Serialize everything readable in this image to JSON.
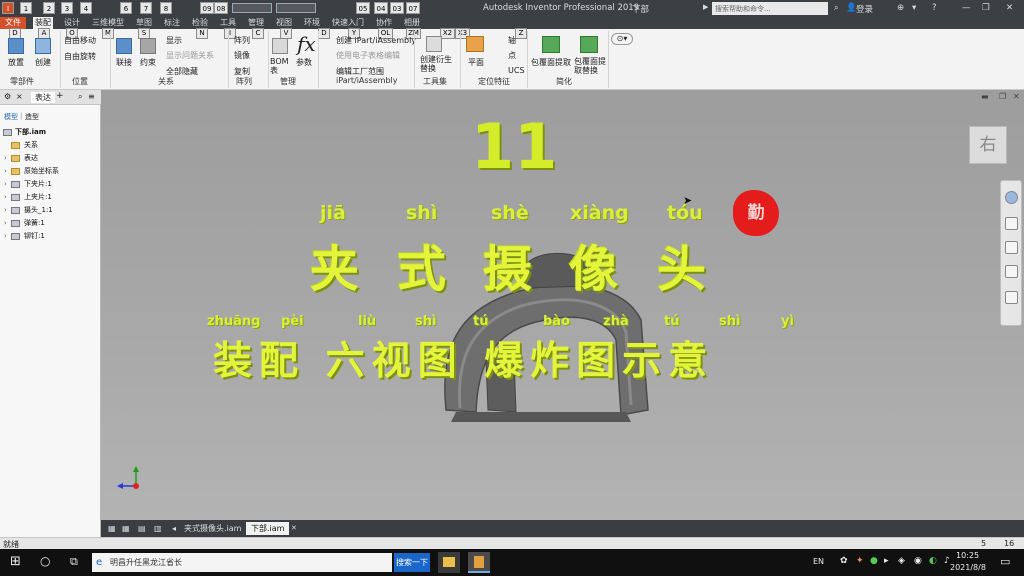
{
  "app": {
    "title": "Autodesk Inventor Professional 2019",
    "document": "下部",
    "search_placeholder": "搜索帮助和命令...",
    "login": "登录"
  },
  "quick_access_keys": [
    "1",
    "2",
    "3",
    "4",
    "6",
    "7",
    "8",
    "09",
    "08"
  ],
  "extra_keys": [
    "05",
    "04",
    "03",
    "07"
  ],
  "menu_tabs": [
    {
      "label": "文件",
      "state": "file"
    },
    {
      "label": "装配",
      "state": "active"
    },
    {
      "label": "设计",
      "state": ""
    },
    {
      "label": "三维模型",
      "state": ""
    },
    {
      "label": "草图",
      "state": ""
    },
    {
      "label": "标注",
      "state": ""
    },
    {
      "label": "检验",
      "state": ""
    },
    {
      "label": "工具",
      "state": ""
    },
    {
      "label": "管理",
      "state": ""
    },
    {
      "label": "视图",
      "state": ""
    },
    {
      "label": "环境",
      "state": ""
    },
    {
      "label": "快速入门",
      "state": ""
    },
    {
      "label": "协作",
      "state": ""
    },
    {
      "label": "相册",
      "state": ""
    }
  ],
  "ribbon": {
    "place": "放置",
    "create": "创建",
    "free_move": "自由移动",
    "free_rotate": "自由旋转",
    "join": "联接",
    "constrain": "约束",
    "show": "显示",
    "show_problems": "显示问题关系",
    "all_hidden": "全部隐藏",
    "pattern": "阵列",
    "mirror": "镜像",
    "copy": "复制",
    "bom": "BOM表",
    "params": "参数",
    "create_ipart": "创建 iPart/iAssembly",
    "use_sheet": "使用电子表格编辑",
    "edit_factory": "编辑工厂范围",
    "create_replace": "创建衍生替换",
    "plane": "平面",
    "axis": "轴",
    "point": "点",
    "ucs": "UCS",
    "shrinkwrap": "包覆面提取",
    "shrinkwrap_sub": "包覆面提取替换",
    "groups": [
      "零部件",
      "位置",
      "关系",
      "阵列",
      "管理",
      "iPart/iAssembly",
      "工具集",
      "定位特征",
      "简化"
    ],
    "key_tips": [
      "D",
      "A",
      "O",
      "M",
      "S",
      "N",
      "I",
      "C",
      "V",
      "D",
      "Y",
      "OL",
      "ZM",
      "X2",
      "X3",
      "Z"
    ]
  },
  "browser": {
    "tabs": [
      "表达",
      "+"
    ],
    "filter_left": "模型",
    "filter_right": "造型",
    "root": "下部.iam",
    "items": [
      "关系",
      "表达",
      "原始坐标系",
      "下夹片:1",
      "上夹片:1",
      "摄头_1:1",
      "弹簧:1",
      "铆钉:1"
    ]
  },
  "overlay": {
    "number": "11",
    "pinyin_top": [
      "jiā",
      "shì",
      "shè",
      "xiàng",
      "tóu"
    ],
    "title_chars": [
      "夹",
      "式",
      "摄",
      "像",
      "头"
    ],
    "pinyin_bottom": [
      "zhuāng",
      "pèi",
      "liù",
      "shì",
      "tú",
      "bào",
      "zhà",
      "tú",
      "shì",
      "yì"
    ],
    "subtitle": "装配 六视图 爆炸图示意",
    "seal": "勤"
  },
  "viewcube_label": "右",
  "doc_tabs": [
    "夹式摄像头.iam",
    "下部.iam"
  ],
  "status": {
    "left": "就绪",
    "right1": "5",
    "right2": "16"
  },
  "taskbar": {
    "search_text": "明昌升任黑龙江省长",
    "search_button": "搜索一下",
    "lang": "EN",
    "time": "10:25",
    "date": "2021/8/8"
  }
}
